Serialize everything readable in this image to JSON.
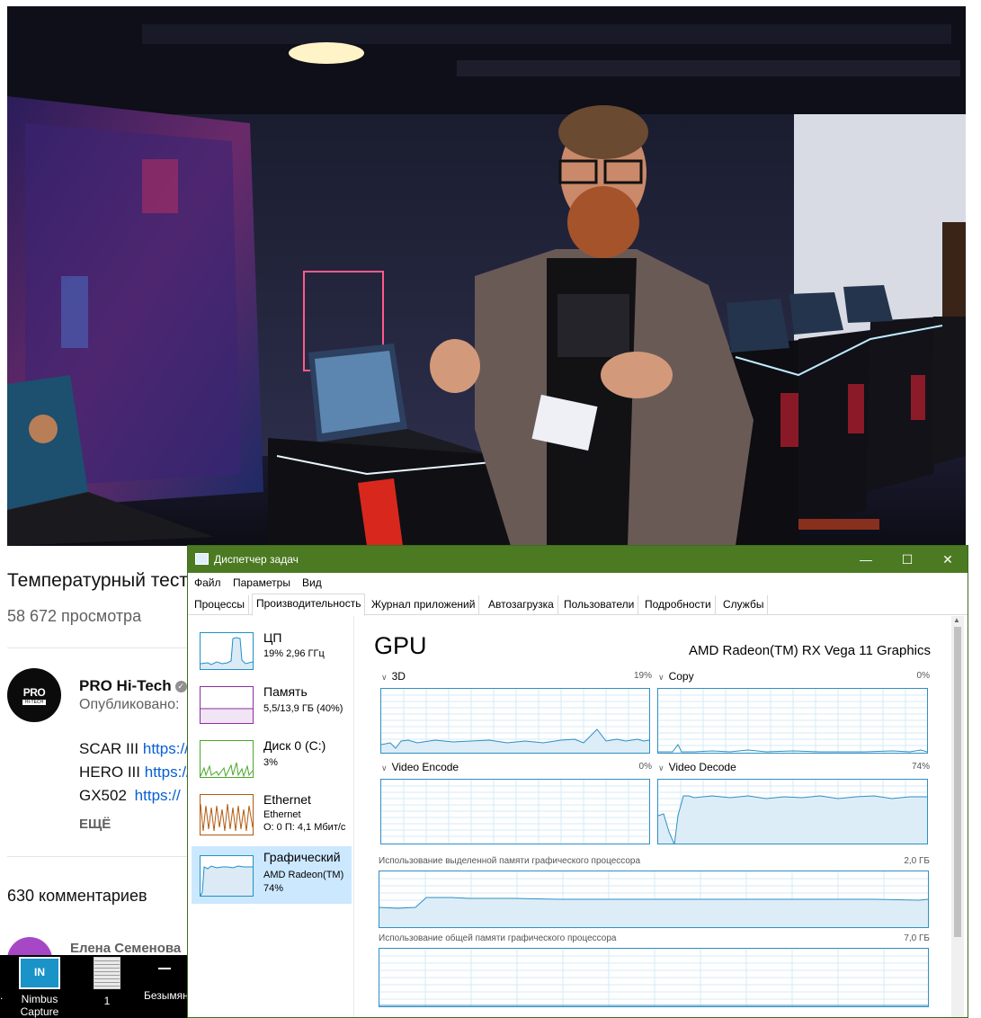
{
  "youtube": {
    "video_title": "Температурный тест",
    "views": "58 672 просмотра",
    "channel_name": "PRO Hi-Tech",
    "avatar_text_top": "PRO",
    "avatar_text_bottom": "HI-TECH",
    "published": "Опубликовано:",
    "description_lines": [
      {
        "label": "SCAR III",
        "link": "https://"
      },
      {
        "label": "HERO III",
        "link": "https://"
      },
      {
        "label": "GX502",
        "link": "https://"
      }
    ],
    "more_label": "ЕЩЁ",
    "comments_count": "630 комментариев",
    "commenter_name": "Елена Семенова"
  },
  "taskbar": {
    "items": [
      {
        "label": "Nimbus Capture",
        "icon": "nimbus-capture-icon",
        "icon_text": "IN"
      },
      {
        "label": "1",
        "icon": "document-icon"
      },
      {
        "label": "Безымян",
        "icon": "dash-icon"
      }
    ]
  },
  "task_manager": {
    "window_title": "Диспетчер задач",
    "controls": {
      "minimize": "—",
      "maximize": "☐",
      "close": "✕"
    },
    "menu": [
      "Файл",
      "Параметры",
      "Вид"
    ],
    "tabs": [
      "Процессы",
      "Производительность",
      "Журнал приложений",
      "Автозагрузка",
      "Пользователи",
      "Подробности",
      "Службы"
    ],
    "active_tab": "Производительность",
    "sidebar": [
      {
        "title": "ЦП",
        "line1": "19%  2,96 ГГц",
        "line2": "",
        "color": "#1e90c8"
      },
      {
        "title": "Память",
        "line1": "5,5/13,9 ГБ (40%)",
        "line2": "",
        "color": "#8b2fa0"
      },
      {
        "title": "Диск 0 (C:)",
        "line1": "3%",
        "line2": "",
        "color": "#4aa82a"
      },
      {
        "title": "Ethernet",
        "line1": "Ethernet",
        "line2": "О: 0 П: 4,1 Мбит/с",
        "color": "#b05a10"
      },
      {
        "title": "Графический",
        "line1": "AMD Radeon(TM)",
        "line2": "74%",
        "color": "#1e90c8"
      }
    ],
    "gpu": {
      "title": "GPU",
      "name": "AMD Radeon(TM) RX Vega 11 Graphics",
      "engines": [
        {
          "label": "3D",
          "pct": "19%"
        },
        {
          "label": "Copy",
          "pct": "0%"
        },
        {
          "label": "Video Encode",
          "pct": "0%"
        },
        {
          "label": "Video Decode",
          "pct": "74%"
        }
      ],
      "dedicated_memory_label": "Использование выделенной памяти графического процессора",
      "dedicated_memory_max": "2,0 ГБ",
      "shared_memory_label": "Использование общей памяти графического процессора",
      "shared_memory_max": "7,0 ГБ"
    },
    "graph_color": "#2f8fc4"
  }
}
